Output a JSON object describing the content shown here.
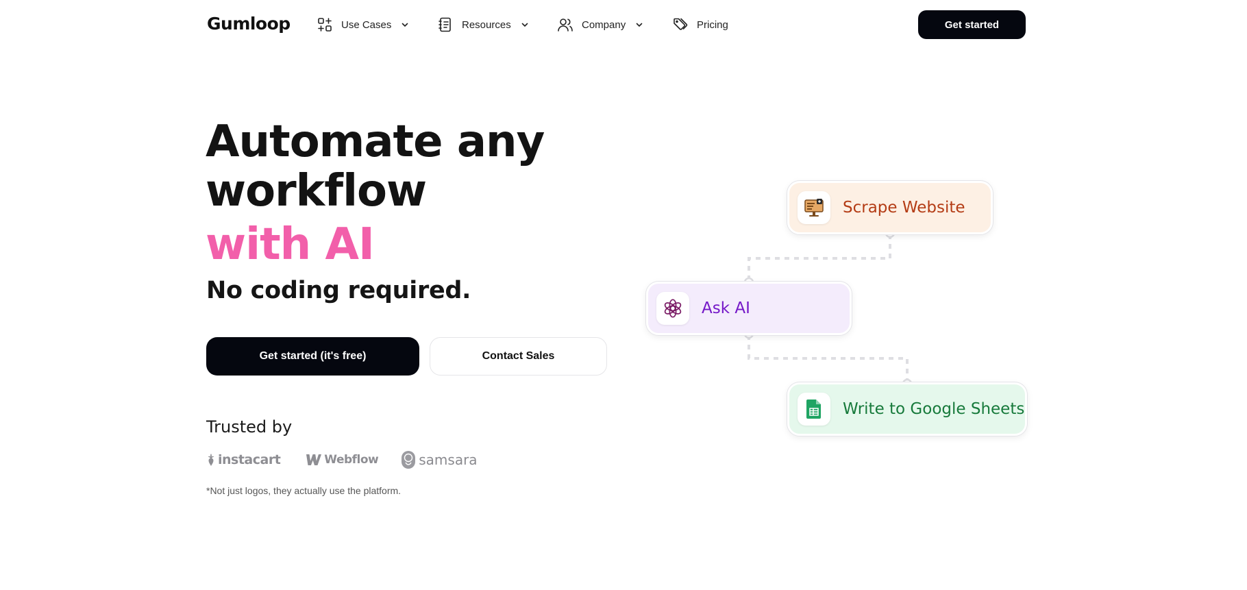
{
  "brand": {
    "logo_text": "Gumloop"
  },
  "nav": {
    "items": [
      {
        "label": "Use Cases",
        "icon": "use-cases-icon",
        "has_dropdown": true
      },
      {
        "label": "Resources",
        "icon": "notebook-icon",
        "has_dropdown": true
      },
      {
        "label": "Company",
        "icon": "users-icon",
        "has_dropdown": true
      },
      {
        "label": "Pricing",
        "icon": "tags-icon",
        "has_dropdown": false
      }
    ],
    "cta_label": "Get started"
  },
  "hero": {
    "title_line1": "Automate any",
    "title_line2": "workflow",
    "title_accent": "with AI",
    "subtitle": "No coding required.",
    "primary_cta": "Get started (it's free)",
    "secondary_cta": "Contact Sales"
  },
  "trusted": {
    "heading": "Trusted by",
    "logos": [
      "instacart",
      "Webflow",
      "samsara"
    ],
    "note": "*Not just logos, they actually use the platform."
  },
  "flow": {
    "nodes": [
      {
        "label": "Scrape Website",
        "icon": "monitor-icon"
      },
      {
        "label": "Ask AI",
        "icon": "openai-icon"
      },
      {
        "label": "Write to Google Sheets",
        "icon": "google-sheets-icon"
      }
    ]
  },
  "colors": {
    "accent_pink": "#f25faa",
    "button_dark": "#05070f",
    "scrape_bg": "#fdf0e4",
    "scrape_text": "#b43c15",
    "ai_bg": "#f4ecfc",
    "ai_text": "#7518c8",
    "sheets_bg": "#e5f8ec",
    "sheets_text": "#177a3b"
  }
}
